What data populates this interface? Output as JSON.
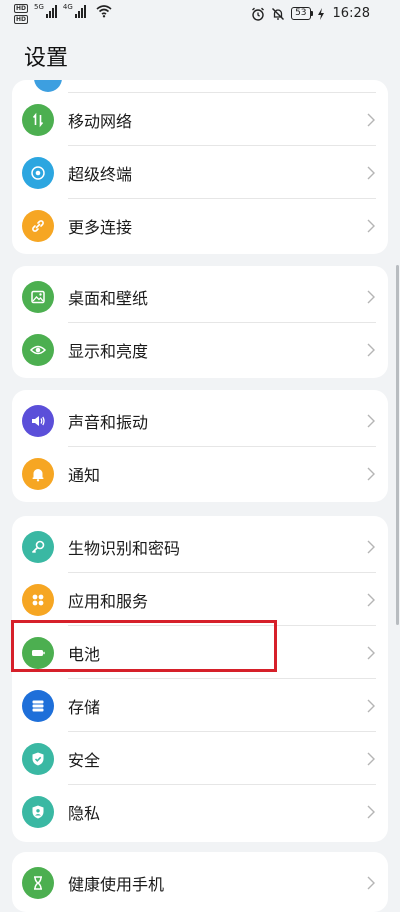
{
  "status": {
    "hd1": "HD",
    "hd2": "HD",
    "net1": "5G",
    "net2": "4G",
    "battery": "53",
    "time": "16:28"
  },
  "header": {
    "title": "设置"
  },
  "groups": [
    {
      "items": [
        {
          "label": "移动网络",
          "icon": "mobile-network-icon",
          "color": "#4caf50"
        },
        {
          "label": "超级终端",
          "icon": "super-device-icon",
          "color": "#2ca6e0"
        },
        {
          "label": "更多连接",
          "icon": "link-icon",
          "color": "#f6a623"
        }
      ]
    },
    {
      "items": [
        {
          "label": "桌面和壁纸",
          "icon": "wallpaper-icon",
          "color": "#4caf50"
        },
        {
          "label": "显示和亮度",
          "icon": "eye-icon",
          "color": "#4caf50"
        }
      ]
    },
    {
      "items": [
        {
          "label": "声音和振动",
          "icon": "speaker-icon",
          "color": "#5b4fd9"
        },
        {
          "label": "通知",
          "icon": "bell-icon",
          "color": "#f6a623"
        }
      ]
    },
    {
      "items": [
        {
          "label": "生物识别和密码",
          "icon": "key-icon",
          "color": "#3ab8a3"
        },
        {
          "label": "应用和服务",
          "icon": "apps-icon",
          "color": "#f6a623"
        },
        {
          "label": "电池",
          "icon": "battery-icon",
          "color": "#4caf50"
        },
        {
          "label": "存储",
          "icon": "storage-icon",
          "color": "#1e6fd9"
        },
        {
          "label": "安全",
          "icon": "shield-icon",
          "color": "#3ab8a3"
        },
        {
          "label": "隐私",
          "icon": "privacy-icon",
          "color": "#3ab8a3"
        }
      ]
    },
    {
      "items": [
        {
          "label": "健康使用手机",
          "icon": "hourglass-icon",
          "color": "#4caf50"
        }
      ]
    }
  ]
}
